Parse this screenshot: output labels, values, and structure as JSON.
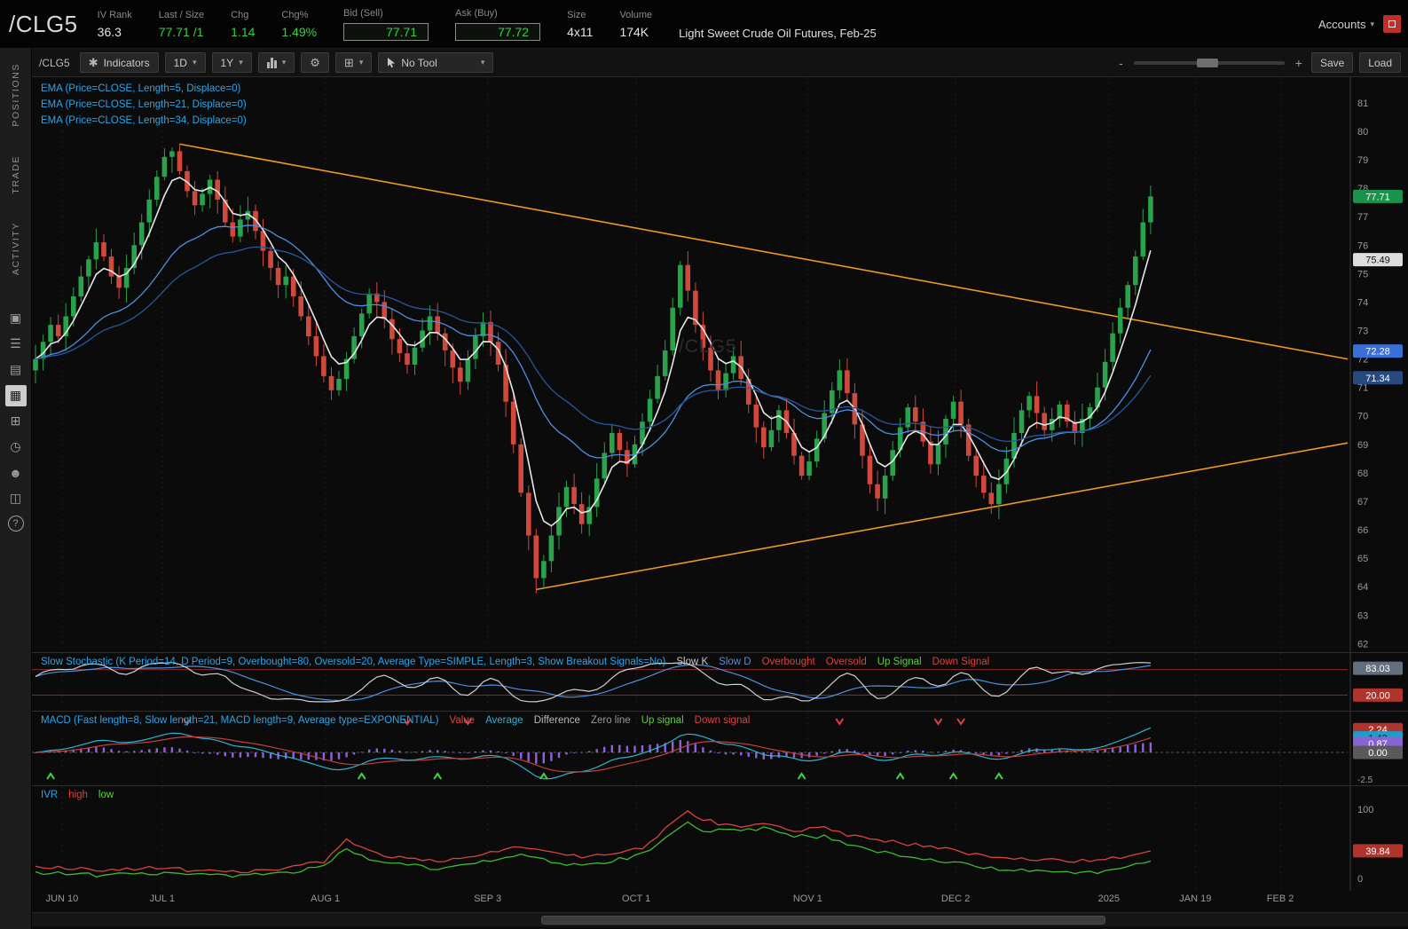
{
  "colors": {
    "up": "#2aa14b",
    "down": "#d0493c",
    "trendline": "#eb9a1e",
    "grid": "#1e1e1e",
    "axis_text": "#9a9a9a",
    "study_label": "#2da5e8",
    "accent_green": "#3ecb4a"
  },
  "header": {
    "symbol": "/CLG5",
    "fields": [
      {
        "label": "IV Rank",
        "value": "36.3"
      },
      {
        "label": "Last / Size",
        "value": "77.71 /1"
      },
      {
        "label": "Chg",
        "value": "1.14"
      },
      {
        "label": "Chg%",
        "value": "1.49%"
      },
      {
        "label": "Bid (Sell)",
        "value": "77.71"
      },
      {
        "label": "Ask (Buy)",
        "value": "77.72"
      },
      {
        "label": "Size",
        "value": "4x11"
      },
      {
        "label": "Volume",
        "value": "174K"
      }
    ],
    "description": "Light Sweet Crude Oil Futures, Feb-25",
    "accounts_label": "Accounts"
  },
  "sidebar": {
    "tabs": [
      "POSITIONS",
      "TRADE",
      "ACTIVITY"
    ],
    "icons": [
      {
        "name": "monitor-icon",
        "glyph": "▣"
      },
      {
        "name": "watchlist-icon",
        "glyph": "☰"
      },
      {
        "name": "scan-icon",
        "glyph": "▤"
      },
      {
        "name": "charts-icon",
        "glyph": "▦",
        "active": true
      },
      {
        "name": "widgets-icon",
        "glyph": "⊞"
      },
      {
        "name": "history-icon",
        "glyph": "◷"
      },
      {
        "name": "community-icon",
        "glyph": "☻"
      },
      {
        "name": "products-icon",
        "glyph": "◫"
      },
      {
        "name": "help-icon",
        "glyph": "?",
        "circled": true
      }
    ]
  },
  "toolbar": {
    "symbol": "/CLG5",
    "indicators_label": "Indicators",
    "timeframe": "1D",
    "range": "1Y",
    "tool_label": "No Tool",
    "zoom_minus": "-",
    "zoom_plus": "+",
    "save_label": "Save",
    "load_label": "Load"
  },
  "studies": {
    "ema_labels": [
      "EMA (Price=CLOSE, Length=5, Displace=0)",
      "EMA (Price=CLOSE, Length=21, Displace=0)",
      "EMA (Price=CLOSE, Length=34, Displace=0)"
    ],
    "stochastic": {
      "title": "Slow Stochastic (K Period=14, D Period=9, Overbought=80, Oversold=20, Average Type=SIMPLE, Length=3, Show Breakout Signals=No)",
      "legend": [
        {
          "text": "Slow K",
          "color": "#c8c8c8"
        },
        {
          "text": "Slow D",
          "color": "#4f8fe0"
        },
        {
          "text": "Overbought",
          "color": "#d9443f"
        },
        {
          "text": "Oversold",
          "color": "#d9443f"
        },
        {
          "text": "Up Signal",
          "color": "#5ecf3e"
        },
        {
          "text": "Down Signal",
          "color": "#d9443f"
        }
      ]
    },
    "macd": {
      "title": "MACD (Fast length=8, Slow length=21, MACD length=9, Average type=EXPONENTIAL)",
      "legend": [
        {
          "text": "Value",
          "color": "#d9443f"
        },
        {
          "text": "Average",
          "color": "#2fb3d4"
        },
        {
          "text": "Difference",
          "color": "#b9b9b9"
        },
        {
          "text": "Zero line",
          "color": "#9a9a9a"
        },
        {
          "text": "Up signal",
          "color": "#5ecf3e"
        },
        {
          "text": "Down signal",
          "color": "#d9443f"
        }
      ]
    },
    "ivr": {
      "title": "IVR",
      "legend": [
        {
          "text": "high",
          "color": "#d9443f"
        },
        {
          "text": "low",
          "color": "#5ecf3e"
        }
      ]
    }
  },
  "chart_data": {
    "type": "candlestick",
    "symbol": "/CLG5",
    "instrument": "Light Sweet Crude Oil Futures, Feb-25",
    "timeframe": "1D",
    "range": "1Y",
    "last_price": 77.71,
    "price_axis": {
      "min": 62,
      "max": 81,
      "step": 1
    },
    "candles": {
      "closes": [
        72.0,
        72.6,
        73.2,
        72.8,
        73.5,
        74.2,
        74.9,
        75.5,
        76.1,
        75.6,
        74.9,
        74.5,
        75.2,
        76.0,
        76.8,
        77.6,
        78.4,
        79.1,
        79.3,
        78.6,
        77.9,
        77.4,
        77.8,
        78.3,
        77.6,
        76.8,
        76.3,
        76.9,
        77.2,
        76.5,
        75.8,
        75.2,
        74.6,
        74.9,
        74.2,
        73.5,
        72.8,
        72.1,
        71.4,
        70.9,
        71.3,
        72.0,
        72.8,
        73.6,
        74.3,
        74.0,
        73.4,
        72.7,
        72.2,
        71.8,
        72.4,
        73.0,
        73.5,
        72.9,
        72.3,
        71.7,
        71.2,
        72.0,
        72.8,
        73.3,
        72.6,
        71.8,
        70.5,
        69.0,
        67.3,
        65.8,
        64.3,
        64.9,
        65.8,
        66.8,
        67.5,
        66.9,
        66.2,
        66.8,
        67.8,
        68.7,
        69.4,
        68.8,
        68.3,
        69.0,
        69.8,
        70.6,
        71.4,
        72.3,
        73.8,
        75.3,
        74.4,
        73.2,
        72.4,
        71.6,
        70.9,
        71.5,
        72.1,
        71.3,
        70.4,
        69.6,
        68.9,
        69.5,
        70.2,
        69.4,
        68.6,
        67.9,
        68.4,
        69.2,
        70.1,
        70.9,
        71.6,
        70.8,
        69.7,
        68.6,
        67.6,
        67.1,
        67.9,
        68.8,
        69.6,
        70.3,
        69.8,
        69.1,
        68.3,
        69.0,
        69.9,
        70.5,
        69.7,
        68.6,
        67.9,
        67.3,
        66.9,
        67.6,
        68.5,
        69.4,
        70.2,
        70.7,
        70.1,
        69.5,
        69.9,
        70.4,
        69.8,
        69.4,
        69.9,
        70.3,
        71.0,
        71.9,
        72.9,
        73.8,
        74.6,
        75.6,
        76.8,
        77.71
      ]
    },
    "ema_periods": [
      5,
      21,
      34
    ],
    "ema_colors": [
      "#e8e8e8",
      "#4f8fe0",
      "#27589d"
    ],
    "trendlines": [
      {
        "i1": 19,
        "p1": 79.55,
        "i2": 174,
        "p2": 71.95
      },
      {
        "i1": 66,
        "p1": 63.9,
        "i2": 174,
        "p2": 69.1
      }
    ],
    "time_ticks": [
      {
        "label": "JUN 10",
        "i": 3.5
      },
      {
        "label": "JUL 1",
        "i": 16.7
      },
      {
        "label": "AUG 1",
        "i": 38.2
      },
      {
        "label": "SEP 3",
        "i": 59.6
      },
      {
        "label": "OCT 1",
        "i": 79.2
      },
      {
        "label": "NOV 1",
        "i": 101.8
      },
      {
        "label": "DEC 2",
        "i": 121.3
      },
      {
        "label": "2025",
        "i": 141.5
      },
      {
        "label": "JAN 19",
        "i": 152.9
      },
      {
        "label": "FEB 2",
        "i": 164.1
      }
    ],
    "price_badges": [
      {
        "text": "77.71",
        "value": 77.71,
        "bg": "#18934c",
        "fg": "#ffffff"
      },
      {
        "text": "75.49",
        "value": 75.49,
        "bg": "#dcdcdc",
        "fg": "#111111"
      },
      {
        "text": "72.28",
        "value": 72.28,
        "bg": "#3a6fd8",
        "fg": "#ffffff"
      },
      {
        "text": "71.34",
        "value": 71.34,
        "bg": "#27497f",
        "fg": "#ffffff"
      }
    ],
    "watermark": "/CLG5",
    "stochastic": {
      "k_period": 14,
      "d_period": 9,
      "overbought": 80,
      "oversold": 20,
      "badges": [
        {
          "text": "83.03",
          "value": 83.03,
          "bg": "#62707e",
          "fg": "#ffffff"
        },
        {
          "text": "20.00",
          "value": 20,
          "bg": "#b0332c",
          "fg": "#ffffff"
        }
      ]
    },
    "macd": {
      "fast": 8,
      "slow": 21,
      "signal": 9,
      "up_signals": [
        2,
        43,
        53,
        67,
        101,
        114,
        121,
        127
      ],
      "down_signals": [
        20,
        49,
        57,
        106,
        119,
        122
      ],
      "badges": [
        {
          "text": "2.24",
          "value": 2.24,
          "bg": "#b0332c",
          "fg": "#ffffff"
        },
        {
          "text": "1.42",
          "value": 1.42,
          "bg": "#1d9ec9",
          "fg": "#0a2830"
        },
        {
          "text": "0.87",
          "value": 0.87,
          "bg": "#8a63d2",
          "fg": "#ffffff"
        },
        {
          "text": "0.00",
          "value": 0,
          "bg": "#5a5a5a",
          "fg": "#ffffff"
        }
      ],
      "axis_label": "-2.5"
    },
    "ivr": {
      "red_points": [
        [
          0,
          18
        ],
        [
          8,
          12
        ],
        [
          16,
          15
        ],
        [
          24,
          10
        ],
        [
          32,
          12
        ],
        [
          38,
          25
        ],
        [
          41,
          55
        ],
        [
          44,
          38
        ],
        [
          48,
          30
        ],
        [
          53,
          26
        ],
        [
          58,
          33
        ],
        [
          62,
          40
        ],
        [
          64,
          48
        ],
        [
          68,
          38
        ],
        [
          72,
          30
        ],
        [
          76,
          35
        ],
        [
          80,
          45
        ],
        [
          84,
          80
        ],
        [
          86,
          97
        ],
        [
          88,
          85
        ],
        [
          92,
          75
        ],
        [
          96,
          78
        ],
        [
          100,
          70
        ],
        [
          104,
          72
        ],
        [
          108,
          60
        ],
        [
          112,
          55
        ],
        [
          116,
          48
        ],
        [
          120,
          42
        ],
        [
          124,
          35
        ],
        [
          128,
          30
        ],
        [
          132,
          28
        ],
        [
          136,
          25
        ],
        [
          140,
          27
        ],
        [
          144,
          30
        ],
        [
          147,
          39.84
        ]
      ],
      "green_points": [
        [
          0,
          8
        ],
        [
          8,
          5
        ],
        [
          16,
          8
        ],
        [
          24,
          4
        ],
        [
          32,
          6
        ],
        [
          38,
          18
        ],
        [
          41,
          45
        ],
        [
          44,
          28
        ],
        [
          48,
          20
        ],
        [
          53,
          15
        ],
        [
          58,
          22
        ],
        [
          62,
          28
        ],
        [
          64,
          35
        ],
        [
          68,
          25
        ],
        [
          72,
          18
        ],
        [
          76,
          25
        ],
        [
          80,
          35
        ],
        [
          84,
          65
        ],
        [
          86,
          80
        ],
        [
          88,
          70
        ],
        [
          92,
          68
        ],
        [
          96,
          72
        ],
        [
          100,
          62
        ],
        [
          104,
          60
        ],
        [
          108,
          45
        ],
        [
          112,
          38
        ],
        [
          116,
          30
        ],
        [
          120,
          25
        ],
        [
          124,
          18
        ],
        [
          128,
          12
        ],
        [
          132,
          10
        ],
        [
          136,
          8
        ],
        [
          140,
          10
        ],
        [
          144,
          15
        ],
        [
          147,
          25
        ]
      ],
      "axis_labels": [
        {
          "text": "100",
          "value": 100
        },
        {
          "text": "0",
          "value": 0
        }
      ],
      "badge": {
        "text": "39.84",
        "value": 39.84,
        "bg": "#b0332c",
        "fg": "#ffffff"
      }
    }
  }
}
